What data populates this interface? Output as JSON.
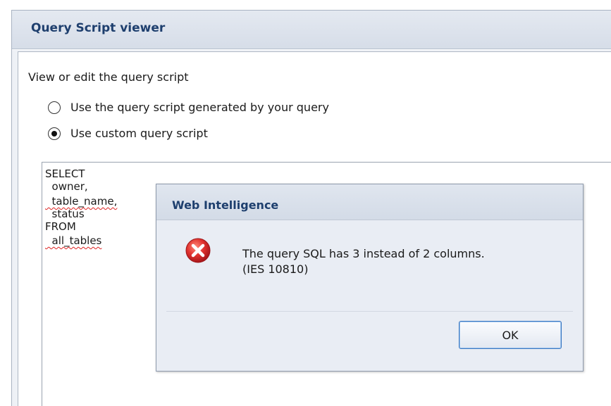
{
  "window": {
    "title": "Query Script viewer"
  },
  "panel": {
    "intro": "View or edit the query script",
    "options": [
      {
        "label": "Use the query script generated by your query",
        "selected": false
      },
      {
        "label": "Use custom query script",
        "selected": true
      }
    ]
  },
  "script": {
    "lines": [
      "SELECT",
      "  owner,",
      "  table_name,",
      "  status",
      "FROM",
      "  all_tables"
    ]
  },
  "dialog": {
    "title": "Web Intelligence",
    "icon": "error-icon",
    "message_line1": "The query SQL has 3 instead of 2 columns.",
    "message_line2": "(IES 10810)",
    "ok_label": "OK"
  },
  "colors": {
    "title_text": "#1e3f6e",
    "error_red": "#d9262a",
    "button_border": "#3a78c2"
  }
}
